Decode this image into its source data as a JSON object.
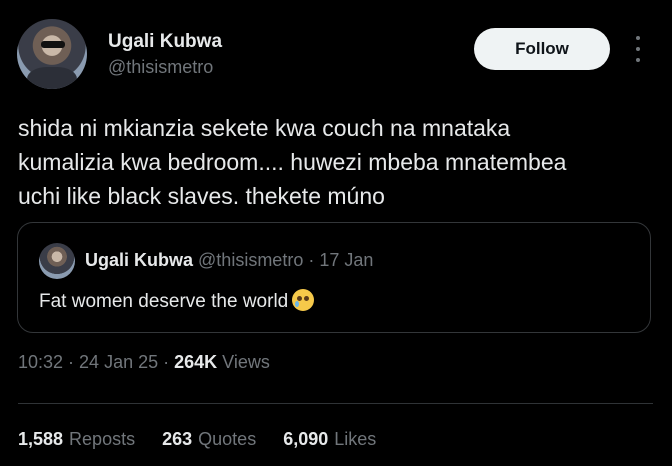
{
  "author": {
    "name": "Ugali Kubwa",
    "handle": "@thisismetro"
  },
  "follow_label": "Follow",
  "post": {
    "lines": [
      "shida ni mkianzia sekete kwa couch na mnataka",
      "kumalizia kwa bedroom.... huwezi mbeba mnatembea",
      "uchi like black slaves. thekete múno"
    ]
  },
  "quoted": {
    "name": "Ugali Kubwa",
    "handle": "@thisismetro",
    "date": "17 Jan",
    "text": "Fat women deserve the world",
    "emoji": "crying-face-emoji"
  },
  "meta": {
    "time": "10:32",
    "date": "24 Jan 25",
    "views_count": "264K",
    "views_label": "Views"
  },
  "stats": {
    "reposts_count": "1,588",
    "reposts_label": "Reposts",
    "quotes_count": "263",
    "quotes_label": "Quotes",
    "likes_count": "6,090",
    "likes_label": "Likes"
  },
  "colors": {
    "background": "#000000",
    "primary_text": "#e7e9ea",
    "secondary_text": "#71767b",
    "follow_button_bg": "#eff3f4",
    "border": "#333639"
  }
}
